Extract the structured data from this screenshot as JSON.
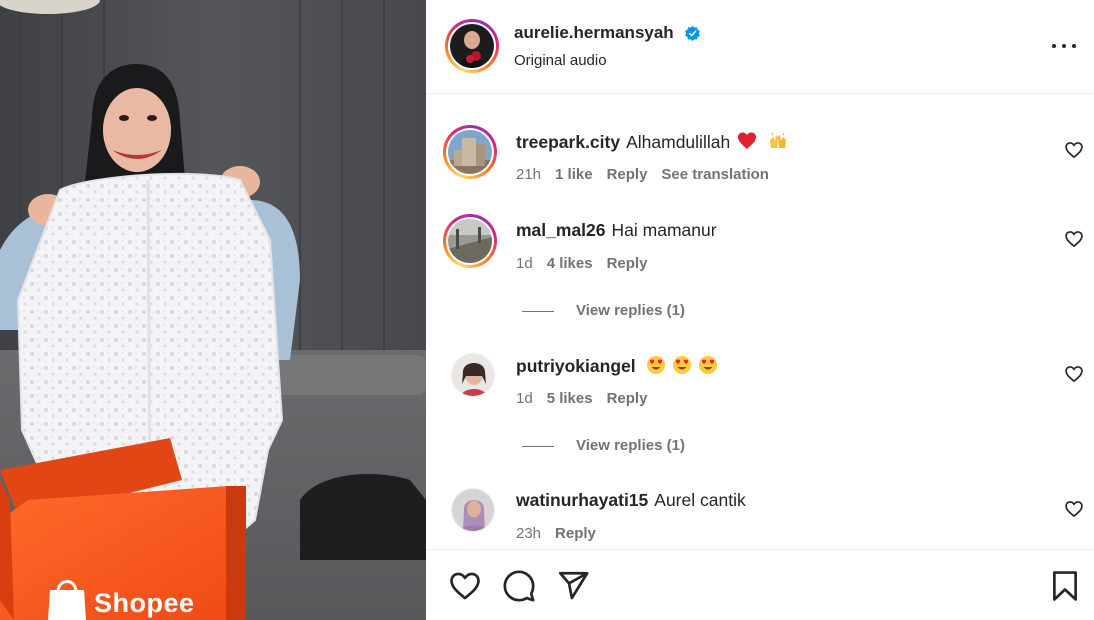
{
  "media": {
    "brand_text": "Shopee",
    "brand_color": "#ee4d2d"
  },
  "header": {
    "username": "aurelie.hermansyah",
    "verified": true,
    "subtitle": "Original audio"
  },
  "comments": [
    {
      "username": "treepark.city",
      "text": "Alhamdulillah",
      "emojis": [
        "red-heart",
        "raising-hands"
      ],
      "time": "21h",
      "likes": "1 like",
      "reply": "Reply",
      "translate": "See translation"
    },
    {
      "username": "mal_mal26",
      "text": "Hai mamanur",
      "time": "1d",
      "likes": "4 likes",
      "reply": "Reply",
      "view_replies": "View replies (1)"
    },
    {
      "username": "putriyokiangel",
      "text": "",
      "emojis": [
        "heart-eyes",
        "heart-eyes",
        "heart-eyes"
      ],
      "time": "1d",
      "likes": "5 likes",
      "reply": "Reply",
      "view_replies": "View replies (1)"
    },
    {
      "username": "watinurhayati15",
      "text": "Aurel cantik",
      "time": "23h",
      "reply": "Reply"
    }
  ],
  "actions": {
    "icons": [
      "heart-icon",
      "comment-icon",
      "share-icon",
      "bookmark-icon"
    ]
  },
  "colors": {
    "text": "#262626",
    "secondary": "#737373",
    "verified": "#0095f6",
    "story_ring": [
      "#feda75",
      "#fa7e1e",
      "#d62976",
      "#962fbf"
    ]
  }
}
